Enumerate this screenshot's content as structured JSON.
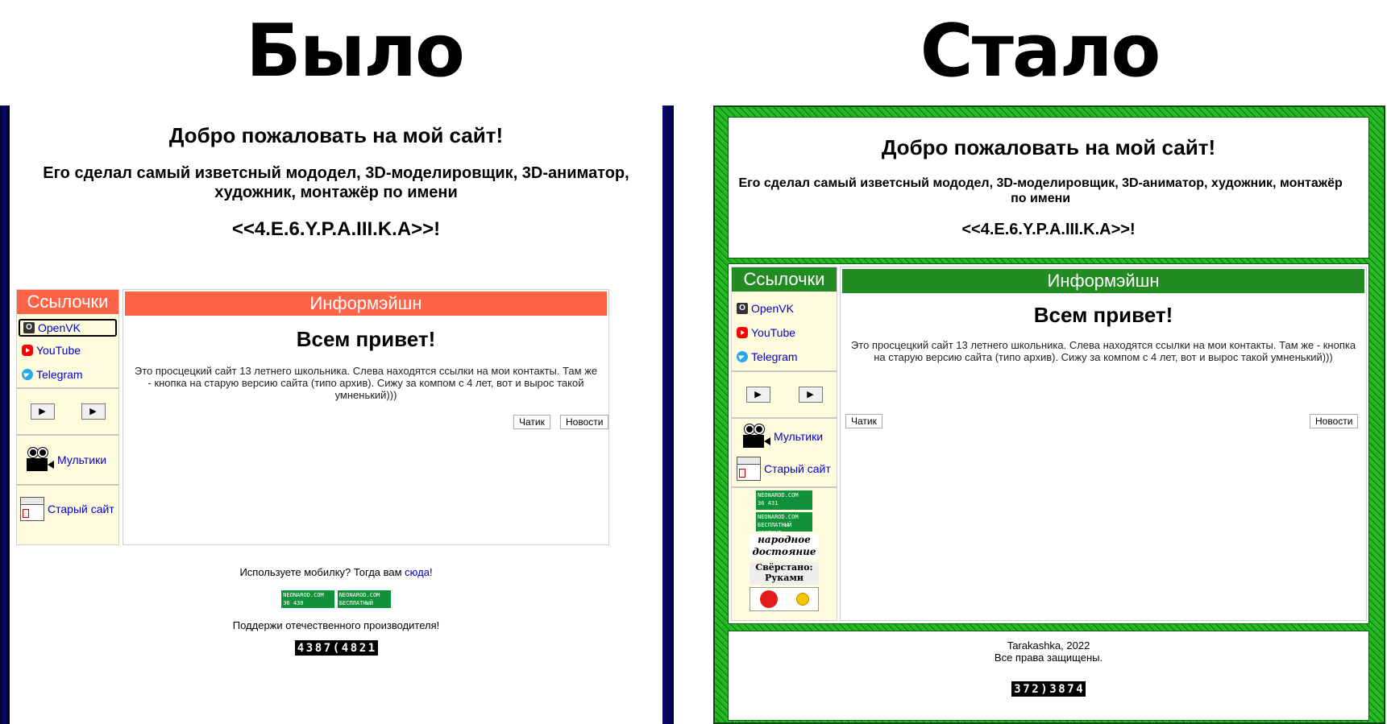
{
  "comparison": {
    "before_label": "Было",
    "after_label": "Стало"
  },
  "site": {
    "welcome": "Добро пожаловать на мой сайт!",
    "subtitle": "Его сделал самый изветсный мододел, 3D-моделировщик, 3D-аниматор, художник, монтажёр по имени",
    "author": "<<4.E.6.Y.P.A.III.K.A>>!",
    "links_header": "Ссылочки",
    "info_header": "Информэйшн",
    "links": [
      {
        "label": "OpenVK",
        "icon": "openvk-icon"
      },
      {
        "label": "YouTube",
        "icon": "youtube-icon"
      },
      {
        "label": "Telegram",
        "icon": "telegram-icon"
      }
    ],
    "play_symbol": "▶",
    "cartoons_label": "Мультики",
    "old_site_label": "Старый сайт",
    "greeting": "Всем привет!",
    "description": "Это просцецкий сайт 13 летнего школьника. Слева находятся ссылки на мои контакты. Там же - кнопка на старую версию сайта (типо архив). Сижу за компом с 4 лет, вот и вырос такой умненький)))",
    "chat_button": "Чатик",
    "news_button": "Новости"
  },
  "old_footer": {
    "mobile_text": "Используете мобилку? Тогда вам ",
    "mobile_link": "сюда",
    "mobile_suffix": "!",
    "support_text": "Поддержи отечественного производителя!",
    "badge_counter_top": "NEONAROD.COM",
    "badge_counter_value": "36 430",
    "badge_hosting_top": "NEONAROD.COM",
    "badge_hosting_text": "БЕСПЛАТНЫЙ ХОСТИНГ",
    "counter_digits": [
      "4",
      "3",
      "8",
      "7",
      "(",
      "4",
      "8",
      "2",
      "1"
    ]
  },
  "new_sidebar_badges": {
    "badge_counter_top": "NEONAROD.COM",
    "badge_counter_value": "36 431",
    "badge_hosting_top": "NEONAROD.COM",
    "badge_hosting_text": "БЕСПЛАТНЫЙ ХОСТИНГ",
    "narod_line1": "народное",
    "narod_line2": "достояние",
    "ruk_line1": "Свёрстано:",
    "ruk_line2": "Руками"
  },
  "new_footer": {
    "copyright": "Tarakashka, 2022",
    "rights": "Все права защищены.",
    "counter_digits": [
      "3",
      "7",
      "2",
      ")",
      "3",
      "8",
      "7",
      "4"
    ]
  },
  "colors": {
    "old_accent": "#ff6347",
    "new_accent": "#228b22",
    "old_border": "#0a0a7a",
    "new_border": "#2ccc2c",
    "link": "#0000cc",
    "sidebar_bg": "#fffbdd"
  }
}
